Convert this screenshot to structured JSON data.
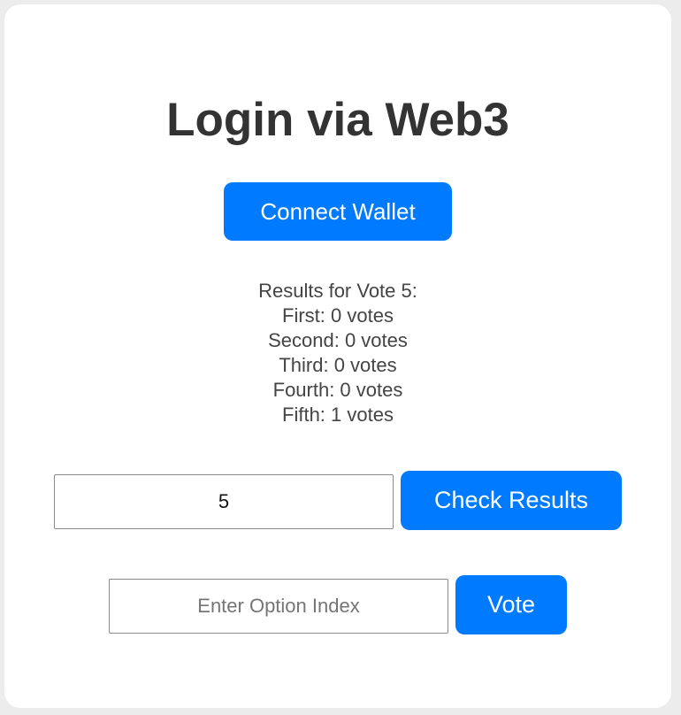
{
  "header": {
    "title": "Login via Web3"
  },
  "wallet": {
    "connect_label": "Connect Wallet"
  },
  "results": {
    "heading": "Results for Vote 5:",
    "lines": [
      "First: 0 votes",
      "Second: 0 votes",
      "Third: 0 votes",
      "Fourth: 0 votes",
      "Fifth: 1 votes"
    ]
  },
  "check": {
    "vote_id_value": "5",
    "button_label": "Check Results"
  },
  "vote": {
    "option_placeholder": "Enter Option Index",
    "button_label": "Vote"
  },
  "colors": {
    "accent": "#007bff",
    "title_text": "#333333",
    "body_text": "#444444",
    "page_background": "#ececec",
    "card_background": "#ffffff"
  }
}
